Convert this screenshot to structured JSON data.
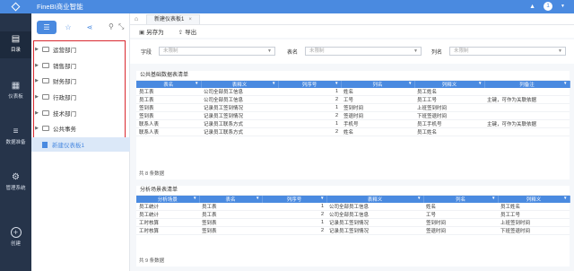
{
  "app": {
    "title": "FineBI商业智能",
    "avatar_initial": "1"
  },
  "nav": [
    {
      "label": "目录",
      "icon": "catalog-icon"
    },
    {
      "label": "仪表板",
      "icon": "dashboard-icon"
    },
    {
      "label": "数据准备",
      "icon": "database-icon"
    },
    {
      "label": "管理系统",
      "icon": "gear-icon"
    },
    {
      "label": "创建",
      "icon": "plus-icon"
    }
  ],
  "folders": [
    "运营部门",
    "销售部门",
    "财务部门",
    "行政部门",
    "技术部门",
    "公共事务"
  ],
  "selected_dashboard": "新建仪表板1",
  "tab": {
    "label": "新建仪表板1"
  },
  "toolbar": {
    "save_as": "另存为",
    "export": "导出"
  },
  "filters": [
    {
      "label": "字段",
      "placeholder": "未限制"
    },
    {
      "label": "表名",
      "placeholder": "未限制"
    },
    {
      "label": "列名",
      "placeholder": "未限制"
    }
  ],
  "table1": {
    "title": "公共基础数据表清单",
    "headers": [
      "表名",
      "表释义",
      "列序号",
      "列名",
      "列释义",
      "列备注"
    ],
    "rows": [
      [
        "员工表",
        "公司全部员工信息",
        "1",
        "姓名",
        "员工姓名",
        ""
      ],
      [
        "员工表",
        "公司全部员工信息",
        "2",
        "工号",
        "员工工号",
        "主键，可作为关联依据"
      ],
      [
        "签到表",
        "记录员工签到情况",
        "1",
        "签到时间",
        "上班签到时间",
        ""
      ],
      [
        "签到表",
        "记录员工签到情况",
        "2",
        "签退时间",
        "下班签退时间",
        ""
      ],
      [
        "联系人表",
        "记录员工联系方式",
        "1",
        "手机号",
        "员工手机号",
        "主键，可作为关联依据"
      ],
      [
        "联系人表",
        "记录员工联系方式",
        "2",
        "姓名",
        "员工姓名",
        ""
      ]
    ],
    "footer": "共 8 条数据"
  },
  "table2": {
    "title": "分析场景表清单",
    "headers": [
      "分析场景",
      "表名",
      "列序号",
      "表释义",
      "列名",
      "列释义"
    ],
    "rows": [
      [
        "员工统计",
        "员工表",
        "1",
        "公司全部员工信息",
        "姓名",
        "员工姓名"
      ],
      [
        "员工统计",
        "员工表",
        "2",
        "公司全部员工信息",
        "工号",
        "员工工号"
      ],
      [
        "工时核算",
        "签到表",
        "1",
        "记录员工签到情况",
        "签到时间",
        "上班签到时间"
      ],
      [
        "工时核算",
        "签到表",
        "2",
        "记录员工签到情况",
        "签退时间",
        "下班签退时间"
      ]
    ],
    "footer": "共 9 条数据"
  }
}
